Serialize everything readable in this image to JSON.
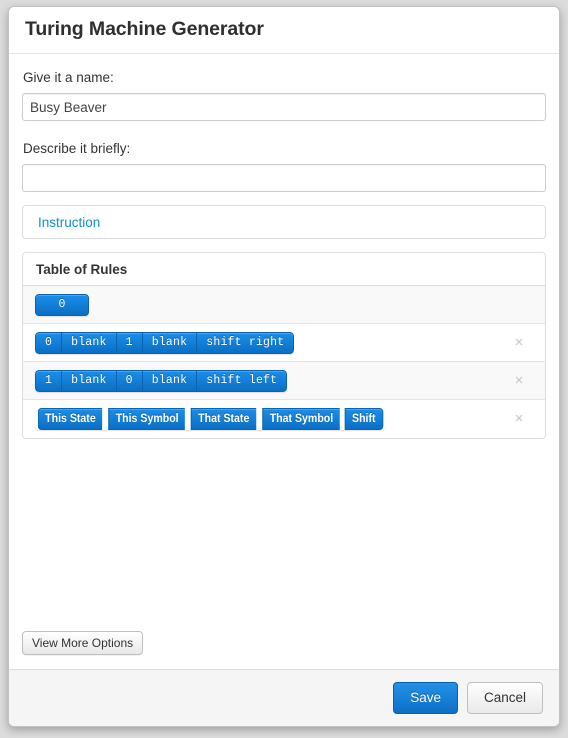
{
  "dialog": {
    "title": "Turing Machine Generator"
  },
  "form": {
    "name_label": "Give it a name:",
    "name_value": "Busy Beaver",
    "name_placeholder": "",
    "description_label": "Describe it briefly:",
    "description_value": "",
    "description_placeholder": ""
  },
  "instruction": {
    "link_label": "Instruction"
  },
  "rules_panel": {
    "heading": "Table of Rules",
    "state_button": "0",
    "remove_icon": "×",
    "rows": [
      {
        "type": "state",
        "segments": [
          "0"
        ]
      },
      {
        "type": "rule",
        "segments": [
          "0",
          "blank",
          "1",
          "blank",
          "shift right"
        ]
      },
      {
        "type": "rule",
        "segments": [
          "1",
          "blank",
          "0",
          "blank",
          "shift left"
        ]
      },
      {
        "type": "header",
        "segments": [
          "This State",
          "This Symbol",
          "That State",
          "That Symbol",
          "Shift"
        ]
      }
    ]
  },
  "options": {
    "view_more_label": "View More Options"
  },
  "footer": {
    "save_label": "Save",
    "cancel_label": "Cancel"
  },
  "colors": {
    "primary_blue": "#0e90d2",
    "button_blue": "#1177cf",
    "backdrop": "#dcdcdc",
    "panel_border": "#dddddd",
    "stripe": "#f9f9f9"
  }
}
